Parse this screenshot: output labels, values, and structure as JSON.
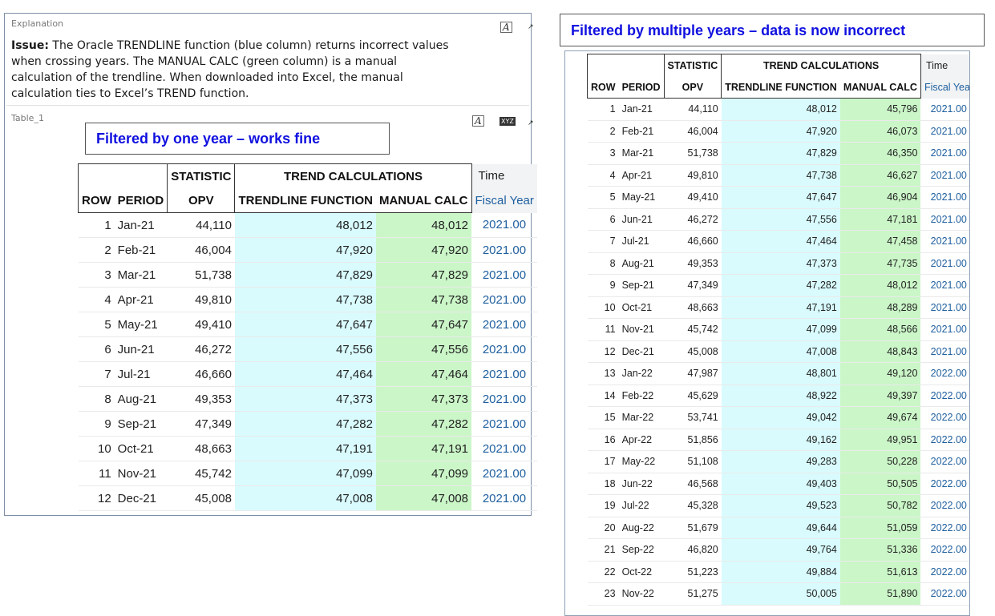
{
  "explanation": {
    "label": "Explanation",
    "issue_label": "Issue:",
    "text": " The Oracle TRENDLINE function (blue column) returns incorrect values when crossing years. The MANUAL CALC (green column) is a manual calculation of the trendline. When downloaded into Excel, the manual calculation ties to Excel’s TREND function.",
    "format_icon": "A",
    "menu_icon": "↗"
  },
  "table1_panel": {
    "label": "Table_1",
    "format_icon": "A",
    "xyz_icon": "XYZ",
    "menu_icon": "↗"
  },
  "callout_left": "Filtered by one year – works fine",
  "callout_right": "Filtered by multiple years – data is now incorrect",
  "headers": {
    "statistic": "STATISTIC",
    "trend_calcs": "TREND CALCULATIONS",
    "time": "Time",
    "row": "ROW",
    "period": "PERIOD",
    "opv": "OPV",
    "trendline": "TRENDLINE FUNCTION",
    "manual": "MANUAL CALC",
    "fiscal_year": "Fiscal Year"
  },
  "colors": {
    "trendline_column": "#d9fbfd",
    "manual_column": "#cbf6c8",
    "callout_text": "#1010e0",
    "fiscal_year_text": "#1f5f9e"
  },
  "table1_rows": [
    {
      "row": "1",
      "period": "Jan-21",
      "opv": "44,110",
      "trend": "48,012",
      "manual": "48,012",
      "year": "2021.00"
    },
    {
      "row": "2",
      "period": "Feb-21",
      "opv": "46,004",
      "trend": "47,920",
      "manual": "47,920",
      "year": "2021.00"
    },
    {
      "row": "3",
      "period": "Mar-21",
      "opv": "51,738",
      "trend": "47,829",
      "manual": "47,829",
      "year": "2021.00"
    },
    {
      "row": "4",
      "period": "Apr-21",
      "opv": "49,810",
      "trend": "47,738",
      "manual": "47,738",
      "year": "2021.00"
    },
    {
      "row": "5",
      "period": "May-21",
      "opv": "49,410",
      "trend": "47,647",
      "manual": "47,647",
      "year": "2021.00"
    },
    {
      "row": "6",
      "period": "Jun-21",
      "opv": "46,272",
      "trend": "47,556",
      "manual": "47,556",
      "year": "2021.00"
    },
    {
      "row": "7",
      "period": "Jul-21",
      "opv": "46,660",
      "trend": "47,464",
      "manual": "47,464",
      "year": "2021.00"
    },
    {
      "row": "8",
      "period": "Aug-21",
      "opv": "49,353",
      "trend": "47,373",
      "manual": "47,373",
      "year": "2021.00"
    },
    {
      "row": "9",
      "period": "Sep-21",
      "opv": "47,349",
      "trend": "47,282",
      "manual": "47,282",
      "year": "2021.00"
    },
    {
      "row": "10",
      "period": "Oct-21",
      "opv": "48,663",
      "trend": "47,191",
      "manual": "47,191",
      "year": "2021.00"
    },
    {
      "row": "11",
      "period": "Nov-21",
      "opv": "45,742",
      "trend": "47,099",
      "manual": "47,099",
      "year": "2021.00"
    },
    {
      "row": "12",
      "period": "Dec-21",
      "opv": "45,008",
      "trend": "47,008",
      "manual": "47,008",
      "year": "2021.00"
    }
  ],
  "table2_rows": [
    {
      "row": "1",
      "period": "Jan-21",
      "opv": "44,110",
      "trend": "48,012",
      "manual": "45,796",
      "year": "2021.00"
    },
    {
      "row": "2",
      "period": "Feb-21",
      "opv": "46,004",
      "trend": "47,920",
      "manual": "46,073",
      "year": "2021.00"
    },
    {
      "row": "3",
      "period": "Mar-21",
      "opv": "51,738",
      "trend": "47,829",
      "manual": "46,350",
      "year": "2021.00"
    },
    {
      "row": "4",
      "period": "Apr-21",
      "opv": "49,810",
      "trend": "47,738",
      "manual": "46,627",
      "year": "2021.00"
    },
    {
      "row": "5",
      "period": "May-21",
      "opv": "49,410",
      "trend": "47,647",
      "manual": "46,904",
      "year": "2021.00"
    },
    {
      "row": "6",
      "period": "Jun-21",
      "opv": "46,272",
      "trend": "47,556",
      "manual": "47,181",
      "year": "2021.00"
    },
    {
      "row": "7",
      "period": "Jul-21",
      "opv": "46,660",
      "trend": "47,464",
      "manual": "47,458",
      "year": "2021.00"
    },
    {
      "row": "8",
      "period": "Aug-21",
      "opv": "49,353",
      "trend": "47,373",
      "manual": "47,735",
      "year": "2021.00"
    },
    {
      "row": "9",
      "period": "Sep-21",
      "opv": "47,349",
      "trend": "47,282",
      "manual": "48,012",
      "year": "2021.00"
    },
    {
      "row": "10",
      "period": "Oct-21",
      "opv": "48,663",
      "trend": "47,191",
      "manual": "48,289",
      "year": "2021.00"
    },
    {
      "row": "11",
      "period": "Nov-21",
      "opv": "45,742",
      "trend": "47,099",
      "manual": "48,566",
      "year": "2021.00"
    },
    {
      "row": "12",
      "period": "Dec-21",
      "opv": "45,008",
      "trend": "47,008",
      "manual": "48,843",
      "year": "2021.00"
    },
    {
      "row": "13",
      "period": "Jan-22",
      "opv": "47,987",
      "trend": "48,801",
      "manual": "49,120",
      "year": "2022.00"
    },
    {
      "row": "14",
      "period": "Feb-22",
      "opv": "45,629",
      "trend": "48,922",
      "manual": "49,397",
      "year": "2022.00"
    },
    {
      "row": "15",
      "period": "Mar-22",
      "opv": "53,741",
      "trend": "49,042",
      "manual": "49,674",
      "year": "2022.00"
    },
    {
      "row": "16",
      "period": "Apr-22",
      "opv": "51,856",
      "trend": "49,162",
      "manual": "49,951",
      "year": "2022.00"
    },
    {
      "row": "17",
      "period": "May-22",
      "opv": "51,108",
      "trend": "49,283",
      "manual": "50,228",
      "year": "2022.00"
    },
    {
      "row": "18",
      "period": "Jun-22",
      "opv": "46,568",
      "trend": "49,403",
      "manual": "50,505",
      "year": "2022.00"
    },
    {
      "row": "19",
      "period": "Jul-22",
      "opv": "45,328",
      "trend": "49,523",
      "manual": "50,782",
      "year": "2022.00"
    },
    {
      "row": "20",
      "period": "Aug-22",
      "opv": "51,679",
      "trend": "49,644",
      "manual": "51,059",
      "year": "2022.00"
    },
    {
      "row": "21",
      "period": "Sep-22",
      "opv": "46,820",
      "trend": "49,764",
      "manual": "51,336",
      "year": "2022.00"
    },
    {
      "row": "22",
      "period": "Oct-22",
      "opv": "51,223",
      "trend": "49,884",
      "manual": "51,613",
      "year": "2022.00"
    },
    {
      "row": "23",
      "period": "Nov-22",
      "opv": "51,275",
      "trend": "50,005",
      "manual": "51,890",
      "year": "2022.00"
    }
  ]
}
